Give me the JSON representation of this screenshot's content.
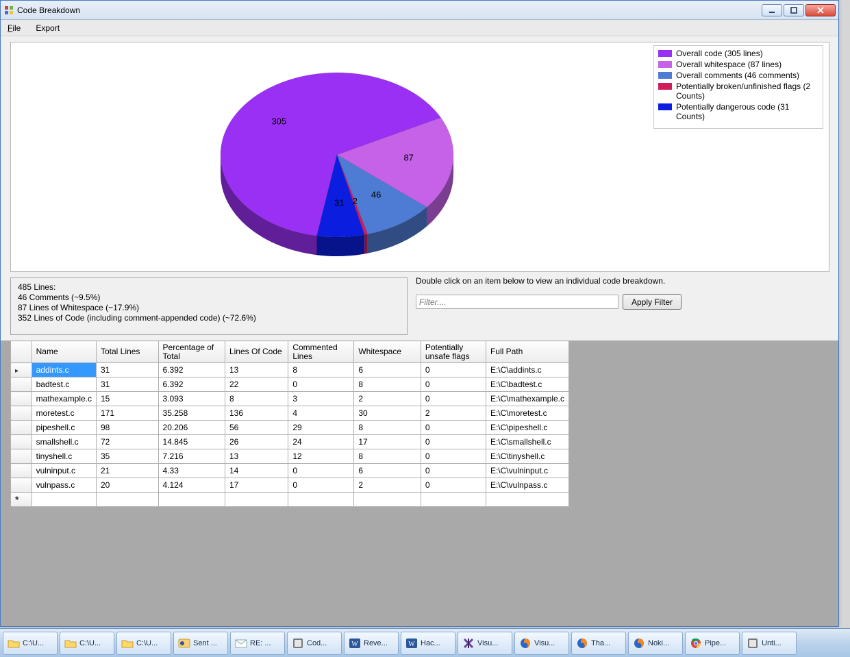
{
  "window": {
    "title": "Code Breakdown"
  },
  "menu": {
    "file": "File",
    "export": "Export"
  },
  "legend": {
    "overall_code": {
      "label": "Overall code (305 lines)",
      "color": "#9b30f5"
    },
    "overall_ws": {
      "label": "Overall whitespace (87 lines)",
      "color": "#c562e8"
    },
    "overall_comm": {
      "label": "Overall comments (46 comments)",
      "color": "#4e7bd3"
    },
    "broken": {
      "label": "Potentially broken/unfinished flags (2 Counts)",
      "color": "#d11c5b"
    },
    "dangerous": {
      "label": "Potentially dangerous code (31 Counts)",
      "color": "#0b1ee0"
    }
  },
  "chart_data": {
    "type": "pie",
    "categories": [
      "Overall code",
      "Overall whitespace",
      "Overall comments",
      "Potentially broken/unfinished flags",
      "Potentially dangerous code"
    ],
    "values": [
      305,
      87,
      46,
      2,
      31
    ],
    "colors": [
      "#9b30f5",
      "#c562e8",
      "#4e7bd3",
      "#d11c5b",
      "#0b1ee0"
    ],
    "title": "",
    "xlabel": "",
    "ylabel": ""
  },
  "summary": {
    "line1": "485 Lines:",
    "line2": "46 Comments (~9.5%)",
    "line3": "87 Lines of Whitespace (~17.9%)",
    "line4": "352 Lines of Code (including comment-appended code) (~72.6%)"
  },
  "filter": {
    "hint": "Double click on an item below to view an individual code breakdown.",
    "placeholder": "Filter....",
    "button": "Apply Filter"
  },
  "grid": {
    "headers": {
      "name": "Name",
      "total": "Total Lines",
      "pct": "Percentage of Total",
      "loc": "Lines Of Code",
      "commented": "Commented Lines",
      "ws": "Whitespace",
      "flags": "Potentially unsafe flags",
      "path": "Full Path"
    },
    "rows": [
      {
        "name": "addints.c",
        "total": "31",
        "pct": "6.392",
        "loc": "13",
        "commented": "8",
        "ws": "6",
        "flags": "0",
        "path": "E:\\C\\addints.c"
      },
      {
        "name": "badtest.c",
        "total": "31",
        "pct": "6.392",
        "loc": "22",
        "commented": "0",
        "ws": "8",
        "flags": "0",
        "path": "E:\\C\\badtest.c"
      },
      {
        "name": "mathexample.c",
        "total": "15",
        "pct": "3.093",
        "loc": "8",
        "commented": "3",
        "ws": "2",
        "flags": "0",
        "path": "E:\\C\\mathexample.c"
      },
      {
        "name": "moretest.c",
        "total": "171",
        "pct": "35.258",
        "loc": "136",
        "commented": "4",
        "ws": "30",
        "flags": "2",
        "path": "E:\\C\\moretest.c"
      },
      {
        "name": "pipeshell.c",
        "total": "98",
        "pct": "20.206",
        "loc": "56",
        "commented": "29",
        "ws": "8",
        "flags": "0",
        "path": "E:\\C\\pipeshell.c"
      },
      {
        "name": "smallshell.c",
        "total": "72",
        "pct": "14.845",
        "loc": "26",
        "commented": "24",
        "ws": "17",
        "flags": "0",
        "path": "E:\\C\\smallshell.c"
      },
      {
        "name": "tinyshell.c",
        "total": "35",
        "pct": "7.216",
        "loc": "13",
        "commented": "12",
        "ws": "8",
        "flags": "0",
        "path": "E:\\C\\tinyshell.c"
      },
      {
        "name": "vulninput.c",
        "total": "21",
        "pct": "4.33",
        "loc": "14",
        "commented": "0",
        "ws": "6",
        "flags": "0",
        "path": "E:\\C\\vulninput.c"
      },
      {
        "name": "vulnpass.c",
        "total": "20",
        "pct": "4.124",
        "loc": "17",
        "commented": "0",
        "ws": "2",
        "flags": "0",
        "path": "E:\\C\\vulnpass.c"
      }
    ]
  },
  "taskbar": {
    "items": [
      {
        "icon": "folder",
        "label": "C:\\U..."
      },
      {
        "icon": "folder",
        "label": "C:\\U..."
      },
      {
        "icon": "folder",
        "label": "C:\\U..."
      },
      {
        "icon": "outlook",
        "label": "Sent ..."
      },
      {
        "icon": "mail",
        "label": "RE: ..."
      },
      {
        "icon": "app",
        "label": "Cod..."
      },
      {
        "icon": "word",
        "label": "Reve..."
      },
      {
        "icon": "word",
        "label": "Hac..."
      },
      {
        "icon": "vs",
        "label": "Visu..."
      },
      {
        "icon": "firefox",
        "label": "Visu..."
      },
      {
        "icon": "firefox",
        "label": "Tha..."
      },
      {
        "icon": "firefox",
        "label": "Noki..."
      },
      {
        "icon": "chrome",
        "label": "Pipe..."
      },
      {
        "icon": "app",
        "label": "Unti..."
      }
    ]
  }
}
